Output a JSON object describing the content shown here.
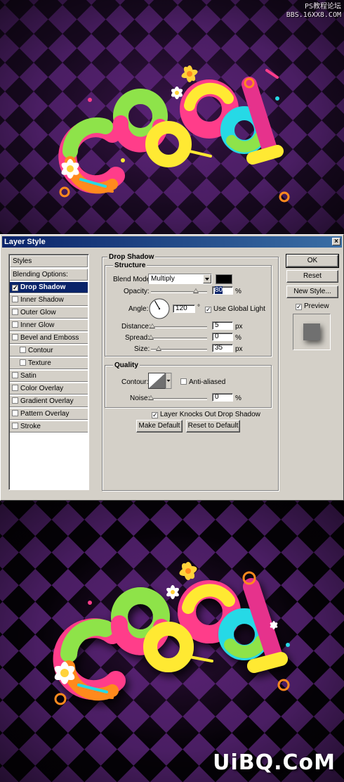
{
  "watermark_top": [
    "PS教程论坛",
    "BBS.16XX8.COM"
  ],
  "watermark_bottom": "UiBQ.CoM",
  "artwork": {
    "letters": [
      "C",
      "O",
      "O",
      "L"
    ],
    "colors": {
      "background_dark": "#1a0a24",
      "background_purple": "#4a1e63",
      "green": "#8ee34a",
      "pink": "#ff3d8a",
      "orange": "#ff8a1e",
      "yellow": "#ffe933",
      "cyan": "#26d9e6",
      "magenta": "#e6328c"
    }
  },
  "dialog": {
    "title": "Layer Style",
    "close_glyph": "×",
    "styles_header": "Styles",
    "blending_options": "Blending Options: Default",
    "style_items": [
      {
        "label": "Drop Shadow",
        "checked": true,
        "selected": true,
        "sub": false
      },
      {
        "label": "Inner Shadow",
        "checked": false,
        "selected": false,
        "sub": false
      },
      {
        "label": "Outer Glow",
        "checked": false,
        "selected": false,
        "sub": false
      },
      {
        "label": "Inner Glow",
        "checked": false,
        "selected": false,
        "sub": false
      },
      {
        "label": "Bevel and Emboss",
        "checked": false,
        "selected": false,
        "sub": false
      },
      {
        "label": "Contour",
        "checked": false,
        "selected": false,
        "sub": true
      },
      {
        "label": "Texture",
        "checked": false,
        "selected": false,
        "sub": true
      },
      {
        "label": "Satin",
        "checked": false,
        "selected": false,
        "sub": false
      },
      {
        "label": "Color Overlay",
        "checked": false,
        "selected": false,
        "sub": false
      },
      {
        "label": "Gradient Overlay",
        "checked": false,
        "selected": false,
        "sub": false
      },
      {
        "label": "Pattern Overlay",
        "checked": false,
        "selected": false,
        "sub": false
      },
      {
        "label": "Stroke",
        "checked": false,
        "selected": false,
        "sub": false
      }
    ],
    "drop_shadow_title": "Drop Shadow",
    "structure_title": "Structure",
    "blend_mode": {
      "label": "Blend Mode:",
      "value": "Multiply",
      "swatch_color": "#000000"
    },
    "opacity": {
      "label": "Opacity:",
      "value": "80",
      "unit": "%",
      "fraction": 0.8
    },
    "angle": {
      "label": "Angle:",
      "value": "120",
      "unit": "°",
      "degrees": 120
    },
    "use_global_light": {
      "label": "Use Global Light",
      "checked": true
    },
    "distance": {
      "label": "Distance:",
      "value": "5",
      "unit": "px",
      "fraction": 0.02
    },
    "spread": {
      "label": "Spread:",
      "value": "0",
      "unit": "%",
      "fraction": 0
    },
    "size": {
      "label": "Size:",
      "value": "35",
      "unit": "px",
      "fraction": 0.14
    },
    "quality_title": "Quality",
    "contour": {
      "label": "Contour:"
    },
    "anti_aliased": {
      "label": "Anti-aliased",
      "checked": false
    },
    "noise": {
      "label": "Noise:",
      "value": "0",
      "unit": "%",
      "fraction": 0
    },
    "knocks_out": {
      "label": "Layer Knocks Out Drop Shadow",
      "checked": true
    },
    "make_default": "Make Default",
    "reset_default": "Reset to Default",
    "ok": "OK",
    "reset": "Reset",
    "new_style": "New Style...",
    "preview": {
      "label": "Preview",
      "checked": true
    }
  }
}
